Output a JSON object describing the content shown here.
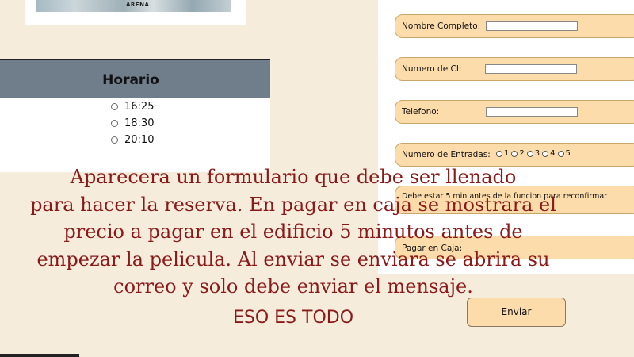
{
  "poster": {
    "text": "ARENA"
  },
  "schedule": {
    "title": "Horario",
    "times": [
      "16:25",
      "18:30",
      "20:10"
    ]
  },
  "form": {
    "name_label": "Nombre Completo:",
    "ci_label": "Numero de CI:",
    "phone_label": "Telefono:",
    "tickets_label": "Numero de Entradas:",
    "ticket_options": [
      "1",
      "2",
      "3",
      "4",
      "5"
    ],
    "notice": "Debe estar 5 min antes de la funcion para reconfirmar",
    "pay_label": "Pagar en Caja:",
    "submit_label": "Enviar"
  },
  "overlay": {
    "paragraph": "Aparecera un formulario que debe ser llenado\npara hacer la reserva. En pagar en caja se mostrara el\nprecio a pagar en el edificio 5 minutos antes de\nempezar la pelicula. Al enviar se enviara se abrira su\ncorreo y solo debe enviar el mensaje.",
    "closing": "ESO ES TODO"
  }
}
